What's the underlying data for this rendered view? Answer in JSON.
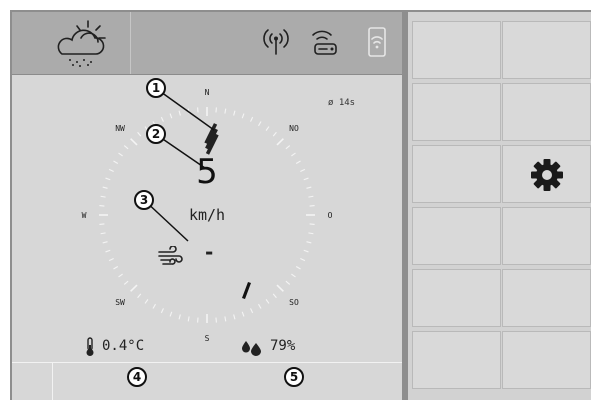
{
  "header": {
    "weather_icon": "cloud-sun-rain-icon",
    "status_icons": [
      "antenna-signal-icon",
      "gps-receiver-icon",
      "mobile-connectivity-icon"
    ]
  },
  "compass": {
    "cardinals": [
      "N",
      "NO",
      "O",
      "SO",
      "S",
      "SW",
      "W",
      "NW"
    ],
    "wind_direction_icon": "wind-direction-arrow-icon",
    "gust_marker_icon": "gust-indicator-icon"
  },
  "status": {
    "timer": "ø 14s"
  },
  "speed": {
    "value": "5",
    "unit": "km/h"
  },
  "gust": {
    "icon": "wind-icon",
    "value": "-"
  },
  "temperature": {
    "icon": "thermometer-icon",
    "value": "0.4°C"
  },
  "humidity": {
    "icon": "water-drops-icon",
    "value": "79%"
  },
  "callouts": [
    "1",
    "2",
    "3",
    "4",
    "5"
  ],
  "right_panel": {
    "settings_icon": "gear-icon",
    "grid_cells": 12
  },
  "colors": {
    "header_bg": "#ababab",
    "panel_bg": "#d7d7d7",
    "frame": "#8e8e8e",
    "tick": "#f4f4f4",
    "text": "#1e1e1e"
  }
}
